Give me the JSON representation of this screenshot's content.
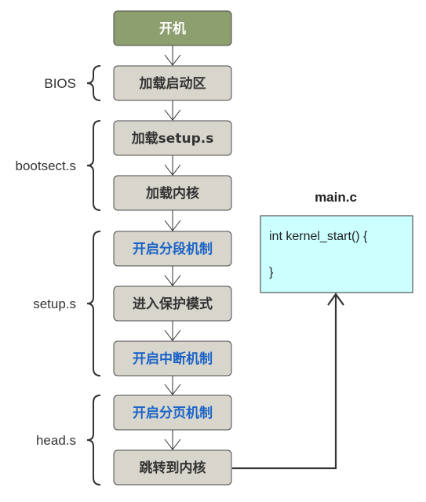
{
  "colors": {
    "start_fill": "#8e9f6f",
    "step_fill": "#d8d6cc",
    "step_border": "#4a4a4a",
    "text_default": "#333333",
    "text_highlight": "#1a63c8",
    "text_start": "#ffffff",
    "code_fill": "#ccffff",
    "code_border": "#333333"
  },
  "steps": [
    {
      "label": "开机",
      "highlight": false,
      "start": true
    },
    {
      "label": "加载启动区",
      "highlight": false
    },
    {
      "label": "加载setup.s",
      "highlight": false
    },
    {
      "label": "加载内核",
      "highlight": false
    },
    {
      "label": "开启分段机制",
      "highlight": true
    },
    {
      "label": "进入保护模式",
      "highlight": false
    },
    {
      "label": "开启中断机制",
      "highlight": true
    },
    {
      "label": "开启分页机制",
      "highlight": true
    },
    {
      "label": "跳转到内核",
      "highlight": false
    }
  ],
  "groups": [
    {
      "label": "BIOS"
    },
    {
      "label": "bootsect.s"
    },
    {
      "label": "setup.s"
    },
    {
      "label": "head.s"
    }
  ],
  "code_panel": {
    "title": "main.c",
    "line1": "int kernel_start() {",
    "line2": "}"
  }
}
